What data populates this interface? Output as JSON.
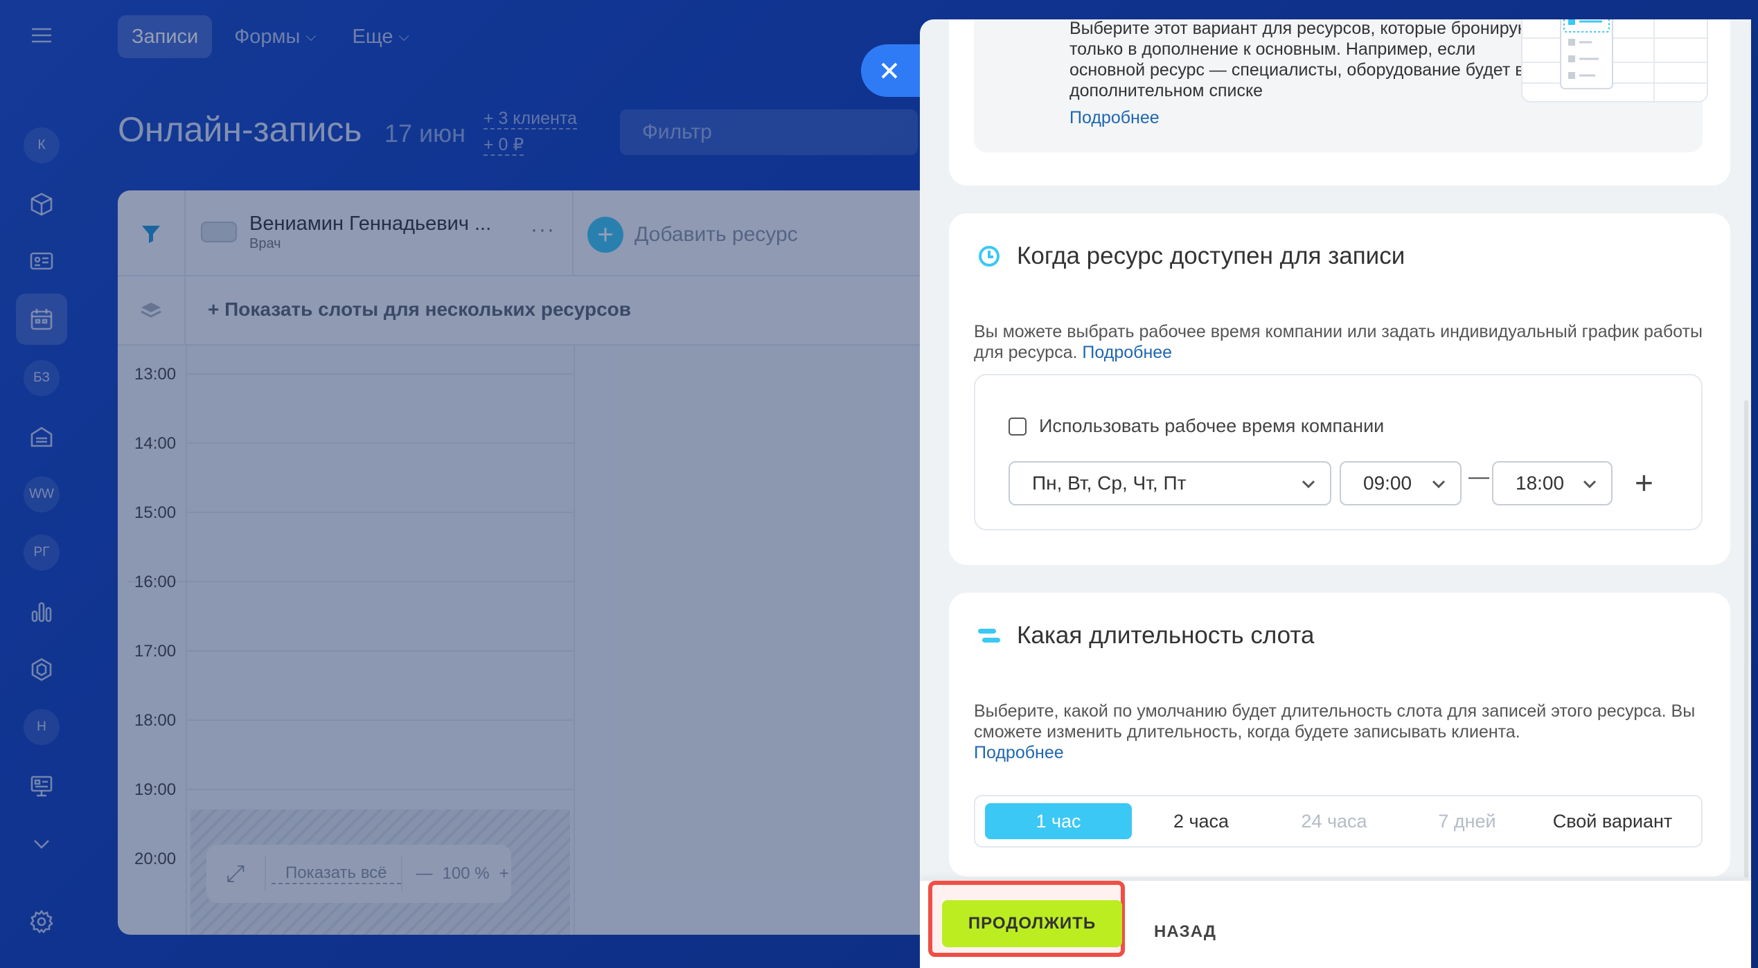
{
  "nav": {
    "items": [
      "Записи",
      "Формы",
      "Еще"
    ]
  },
  "sidebar": {
    "avatars": [
      "К",
      "БЗ",
      "WW",
      "РГ",
      "Н"
    ]
  },
  "header": {
    "title": "Онлайн-запись",
    "date": "17 июн",
    "clients": "+ 3 клиента",
    "revenue": "+ 0 ₽",
    "filter_placeholder": "Фильтр"
  },
  "calendar": {
    "resource_name": "Вениамин Геннадьевич ...",
    "resource_role": "Врач",
    "add_resource": "Добавить ресурс",
    "show_slots": "+ Показать слоты для нескольких ресурсов",
    "hours": [
      "13:00",
      "14:00",
      "15:00",
      "16:00",
      "17:00",
      "18:00",
      "19:00",
      "20:00"
    ],
    "show_all": "Показать всё",
    "zoom": "100 %",
    "zoom_minus": "—",
    "zoom_plus": "+"
  },
  "panel": {
    "card1": {
      "description": "Выберите этот вариант для ресурсов, которые бронируют только в дополнение к основным. Например, если основной ресурс — специалисты, оборудование будет в дополнительном списке",
      "more": "Подробнее"
    },
    "card2": {
      "title": "Когда ресурс доступен для записи",
      "description": "Вы можете выбрать рабочее время компании или задать индивидуальный график работы для ресурса.",
      "more": "Подробнее",
      "checkbox_label": "Использовать рабочее время компании",
      "days": "Пн, Вт, Ср, Чт, Пт",
      "from": "09:00",
      "dash": "—",
      "to": "18:00",
      "add": "+"
    },
    "card3": {
      "title": "Какая длительность слота",
      "description": "Выберите, какой по умолчанию будет длительность слота для записей этого ресурса. Вы сможете изменить длительность, когда будете записывать клиента.",
      "more": "Подробнее",
      "tabs": [
        "1 час",
        "2 часа",
        "24 часа",
        "7 дней",
        "Свой вариант"
      ]
    },
    "footer": {
      "continue": "ПРОДОЛЖИТЬ",
      "back": "НАЗАД"
    }
  },
  "colors": {
    "accent_blue": "#3bc8f5",
    "continue_green": "#bbed21",
    "highlight_red": "#ef4f45",
    "link": "#2067b0"
  }
}
